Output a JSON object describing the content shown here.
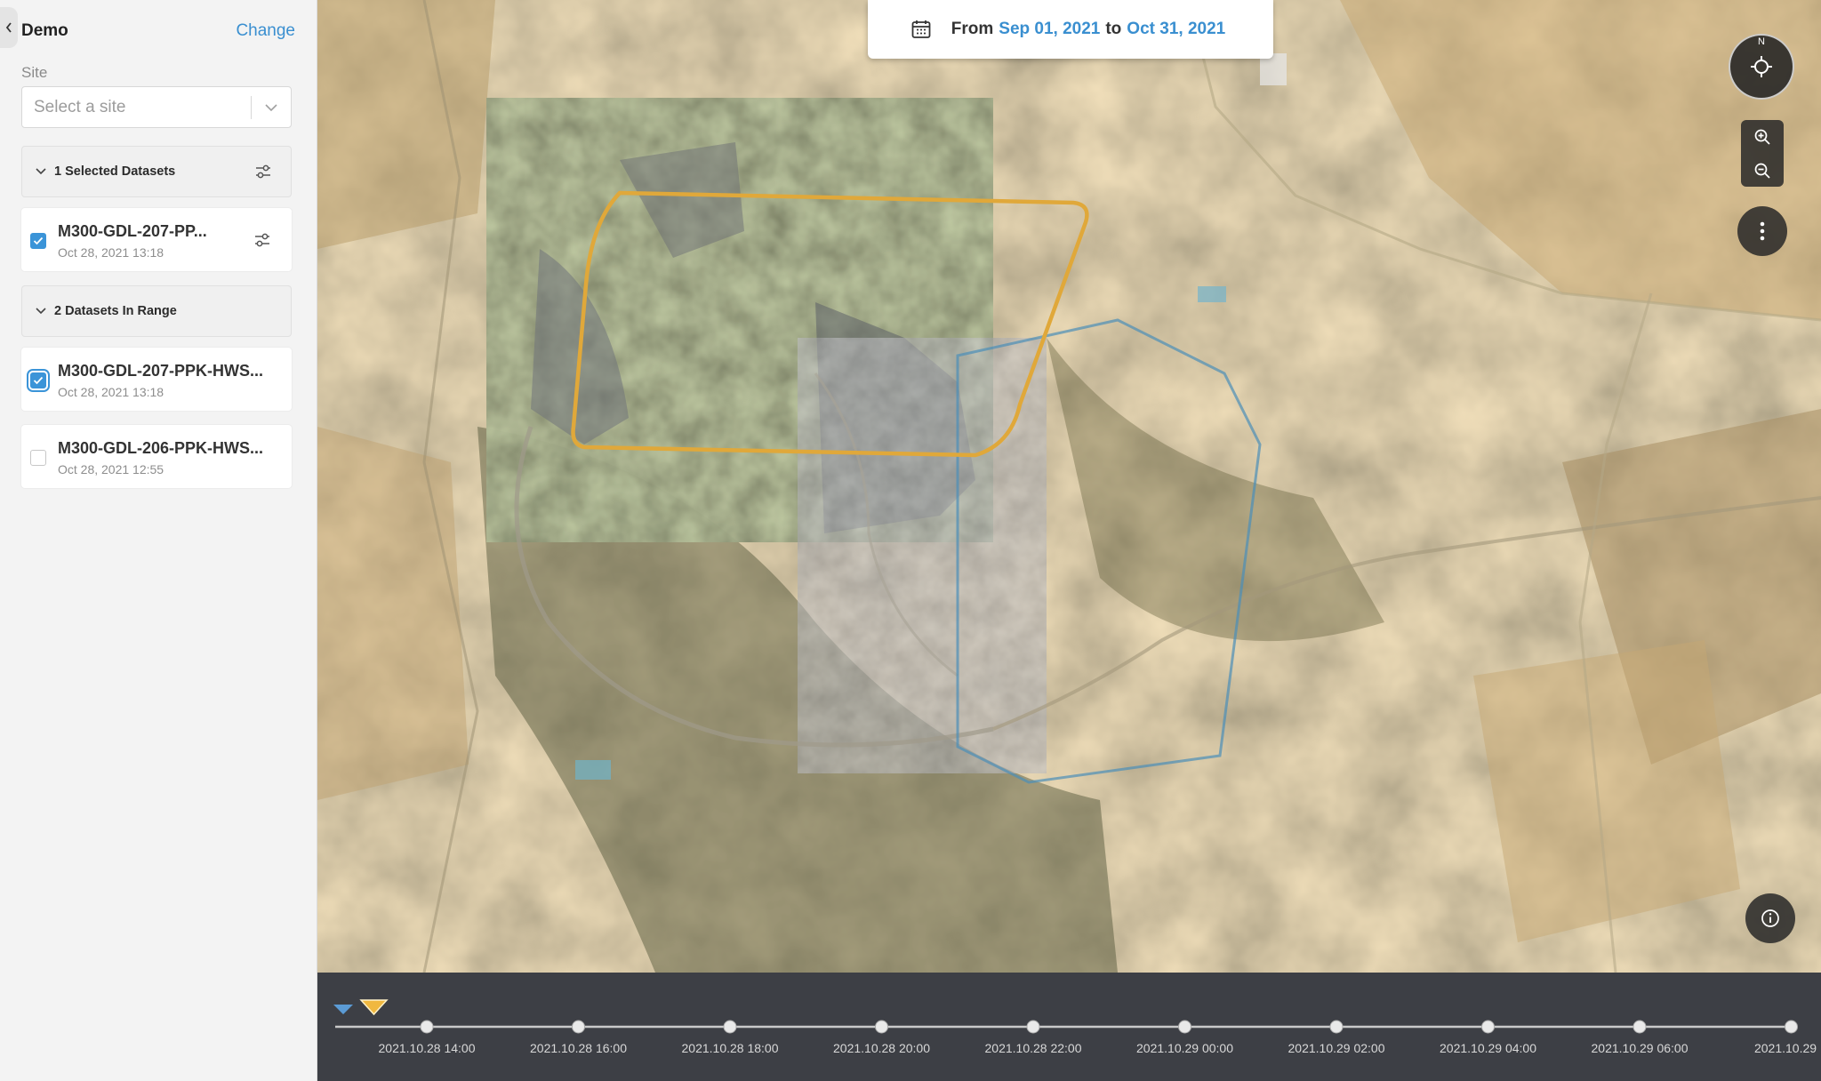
{
  "sidebar": {
    "project_name": "Demo",
    "change_label": "Change",
    "site_label": "Site",
    "site_placeholder": "Select a site",
    "selected_group": {
      "title": "1 Selected Datasets",
      "items": [
        {
          "name": "M300-GDL-207-PP...",
          "date": "Oct 28, 2021 13:18",
          "checked": true
        }
      ]
    },
    "range_group": {
      "title": "2 Datasets In Range",
      "items": [
        {
          "name": "M300-GDL-207-PPK-HWS...",
          "date": "Oct 28, 2021 13:18",
          "checked": true
        },
        {
          "name": "M300-GDL-206-PPK-HWS...",
          "date": "Oct 28, 2021 12:55",
          "checked": false
        }
      ]
    }
  },
  "date_range": {
    "from_label": "From",
    "from_date": "Sep 01, 2021",
    "to_label": "to",
    "to_date": "Oct 31, 2021"
  },
  "map_controls": {
    "compass_label": "N",
    "overlay_colors": {
      "primary_boundary": "#e0a83a",
      "secondary_boundary": "#4c8fb8"
    }
  },
  "timeline": {
    "ticks": [
      "2021.10.28 14:00",
      "2021.10.28 16:00",
      "2021.10.28 18:00",
      "2021.10.28 20:00",
      "2021.10.28 22:00",
      "2021.10.29 00:00",
      "2021.10.29 02:00",
      "2021.10.29 04:00",
      "2021.10.29 06:00",
      "2021.10.29"
    ],
    "marker_colors": {
      "blue": "#5b9bd5",
      "orange": "#f0b840"
    }
  },
  "colors": {
    "accent": "#3a8fd0"
  }
}
